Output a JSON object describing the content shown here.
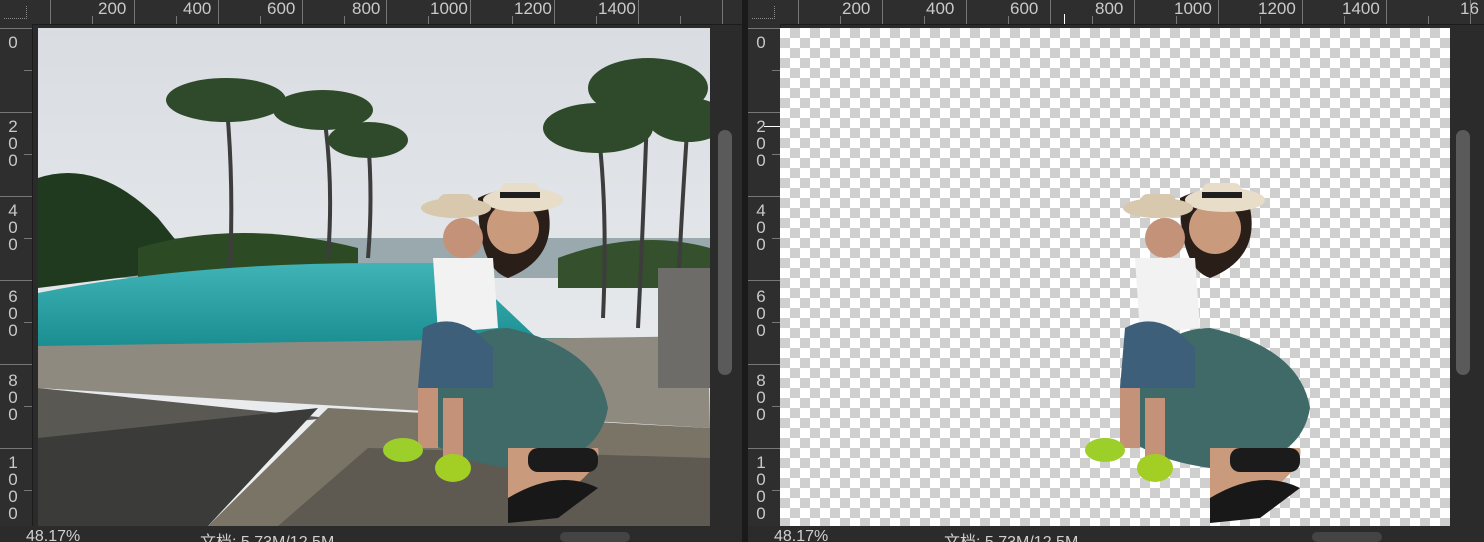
{
  "ruler": {
    "h_labels": [
      "200",
      "400",
      "600",
      "800",
      "1000",
      "1200",
      "1400",
      "16"
    ],
    "v_labels_left": [
      [
        "0"
      ],
      [
        "2",
        "0",
        "0"
      ],
      [
        "4",
        "0",
        "0"
      ],
      [
        "6",
        "0",
        "0"
      ],
      [
        "8",
        "0",
        "0"
      ],
      [
        "1",
        "0",
        "0",
        "0"
      ]
    ]
  },
  "left_doc": {
    "zoom": "48.17%",
    "doc_info": "文档: 5.73M/12.5M"
  },
  "right_doc": {
    "zoom": "48.17%",
    "doc_info": "文档: 5.73M/12.5M"
  },
  "colors": {
    "canvas_bg": "#2b2b2b",
    "ruler_bg": "#2e2e2e",
    "checker_light": "#ffffff",
    "checker_dark": "#cfcfcf"
  },
  "icons": {
    "photo": "beach-pool-photo-icon",
    "cutout": "people-cutout-icon"
  }
}
